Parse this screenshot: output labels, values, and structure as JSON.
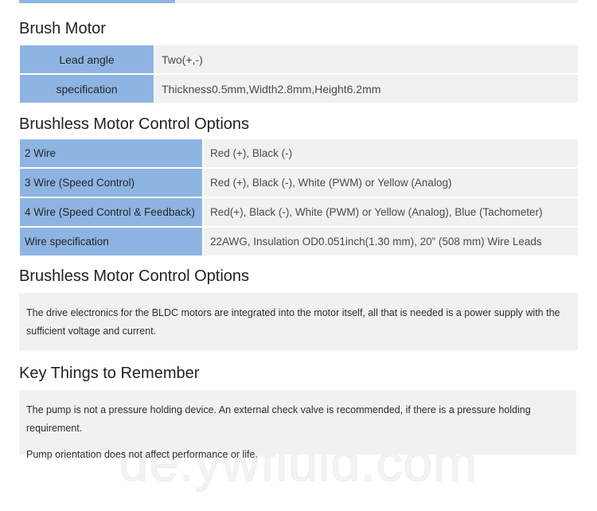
{
  "page": {
    "watermark": "de.ywfluid.com",
    "accent_blue": "#8eb4e3",
    "panel_gray": "#f1f1f1",
    "background": "#ffffff"
  },
  "sections": {
    "brush_motor": {
      "heading": "Brush Motor",
      "rows": [
        {
          "label": "Lead angle",
          "value": "Two(+,-)"
        },
        {
          "label": "specification",
          "value": "Thickness0.5mm,Width2.8mm,Height6.2mm"
        }
      ]
    },
    "brushless_options_table": {
      "heading": "Brushless Motor Control Options",
      "rows": [
        {
          "label": "2 Wire",
          "value": "Red (+), Black (-)"
        },
        {
          "label": "3 Wire (Speed Control)",
          "value": "Red (+), Black (-), White (PWM) or Yellow (Analog)"
        },
        {
          "label": "4 Wire (Speed Control & Feedback)",
          "value": "Red(+), Black (-), White (PWM) or Yellow (Analog), Blue (Tachometer)"
        },
        {
          "label": "Wire specification",
          "value": "22AWG, Insulation OD0.051inch(1.30 mm), 20” (508 mm) Wire Leads"
        }
      ]
    },
    "brushless_options_note": {
      "heading": "Brushless Motor Control Options",
      "paragraphs": [
        "The drive electronics for the BLDC motors are integrated into the motor itself, all that is needed is a power supply with the sufficient voltage and current."
      ]
    },
    "key_things": {
      "heading": "Key Things to Remember",
      "paragraphs": [
        "The pump is not a pressure holding device. An external check valve is recommended, if there is a pressure holding requirement.",
        "Pump orientation does not affect performance or life."
      ]
    }
  }
}
